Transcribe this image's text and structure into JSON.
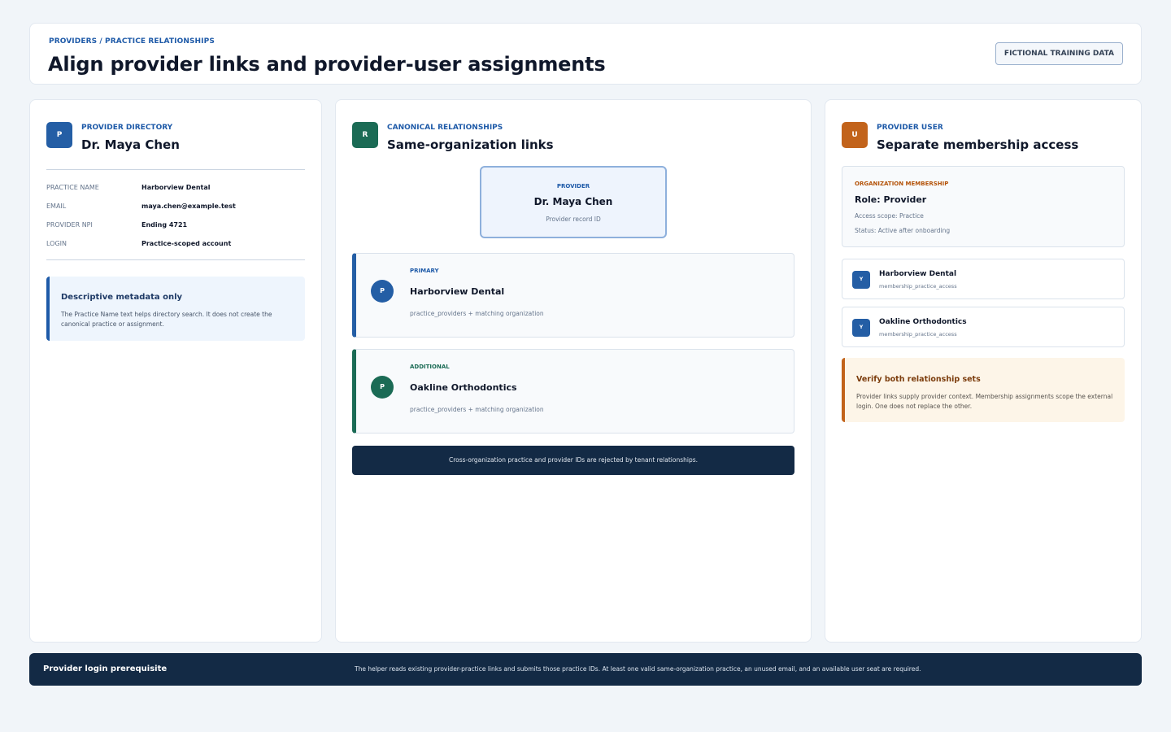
{
  "colors": {
    "brand_blue": "#1e5aa8",
    "green": "#1b6b55",
    "orange": "#c2631b",
    "navy": "#132a45"
  },
  "header": {
    "breadcrumb": "PROVIDERS / PRACTICE RELATIONSHIPS",
    "title": "Align provider links and provider-user assignments",
    "badge": "FICTIONAL TRAINING DATA"
  },
  "directory": {
    "avatar": "P",
    "kicker": "PROVIDER DIRECTORY",
    "name": "Dr. Maya Chen",
    "fields": [
      {
        "label": "PRACTICE NAME",
        "value": "Harborview Dental"
      },
      {
        "label": "EMAIL",
        "value": "maya.chen@example.test"
      },
      {
        "label": "PROVIDER NPI",
        "value": "Ending 4721"
      },
      {
        "label": "LOGIN",
        "value": "Practice-scoped account"
      }
    ],
    "note": {
      "title": "Descriptive metadata only",
      "body": "The Practice Name text helps directory search. It does not create the canonical practice or assignment."
    }
  },
  "relationships": {
    "avatar": "R",
    "kicker": "CANONICAL RELATIONSHIPS",
    "title": "Same-organization links",
    "provider": {
      "kicker": "PROVIDER",
      "name": "Dr. Maya Chen",
      "sub": "Provider record ID"
    },
    "links": [
      {
        "dot": "P",
        "kicker": "PRIMARY",
        "name": "Harborview Dental",
        "sub": "practice_providers + matching organization"
      },
      {
        "dot": "P",
        "kicker": "ADDITIONAL",
        "name": "Oakline Orthodontics",
        "sub": "practice_providers + matching organization"
      }
    ],
    "warning": "Cross-organization practice and provider IDs are rejected by tenant relationships."
  },
  "user": {
    "avatar": "U",
    "kicker": "PROVIDER USER",
    "title": "Separate membership access",
    "membership": {
      "kicker": "ORGANIZATION MEMBERSHIP",
      "role": "Role: Provider",
      "scope": "Access scope: Practice",
      "status": "Status: Active after onboarding"
    },
    "assignments": [
      {
        "avatar": "Y",
        "name": "Harborview Dental",
        "sub": "membership_practice_access"
      },
      {
        "avatar": "Y",
        "name": "Oakline Orthodontics",
        "sub": "membership_practice_access"
      }
    ],
    "note": {
      "title": "Verify both relationship sets",
      "body": "Provider links supply provider context. Membership assignments scope the external login. One does not replace the other."
    }
  },
  "footer": {
    "title": "Provider login prerequisite",
    "text": "The helper reads existing provider-practice links and submits those practice IDs. At least one valid same-organization practice, an unused email, and an available user seat are required."
  }
}
